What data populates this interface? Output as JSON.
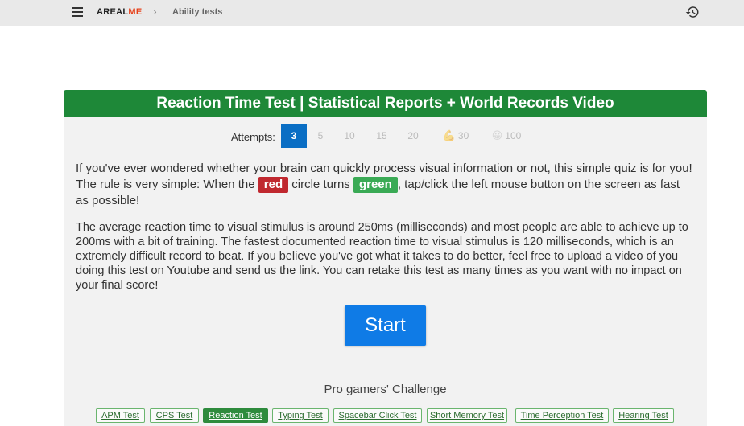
{
  "header": {
    "brand_prefix": "AREAL",
    "brand_accent": "ME",
    "breadcrumb_sep": "›",
    "breadcrumb": "Ability tests"
  },
  "card": {
    "title": "Reaction Time Test | Statistical Reports + World Records Video"
  },
  "attempts": {
    "label": "Attempts:",
    "options": [
      "3",
      "5",
      "10",
      "15",
      "20",
      "30",
      "100"
    ],
    "selected": "3"
  },
  "intro": {
    "part1": "If you've ever wondered whether your brain can quickly process visual information or not, this simple quiz is for you! The rule is very simple: When the ",
    "red_word": "red",
    "part2": " circle turns ",
    "green_word": "green",
    "part3": ", tap/click the left mouse button on the screen as fast as possible!"
  },
  "details": "The average reaction time to visual stimulus is around 250ms (milliseconds) and most people are able to achieve up to 200ms with a bit of training. The fastest documented reaction time to visual stimulus is 120 milliseconds, which is an extremely difficult record to beat. If you believe you've got what it takes to do better, feel free to upload a video of you doing this test on Youtube and send us the link. You can retake this test as many times as you want with no impact on your final score!",
  "start_label": "Start",
  "challenge_title": "Pro gamers' Challenge",
  "tests": [
    "APM Test",
    "CPS Test",
    "Reaction Test",
    "Typing Test",
    "Spacebar Click Test",
    "Short Memory Test",
    "Time Perception Test",
    "Hearing Test"
  ],
  "active_test": "Reaction Test",
  "colors": {
    "header_green": "#1e8838",
    "accent_blue": "#0a6ec4",
    "start_blue": "#0f7be6",
    "red_tag": "#c0282f",
    "green_tag": "#3aaa55",
    "brand_accent": "#e8411a"
  }
}
